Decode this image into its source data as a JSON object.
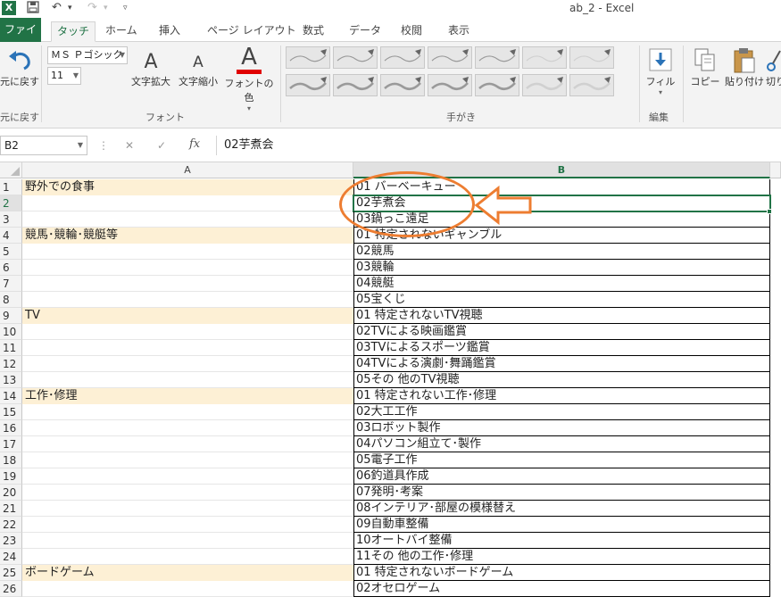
{
  "window": {
    "title": "ab_2 - Excel"
  },
  "tabs": [
    "ファイル",
    "タッチ",
    "ホーム",
    "挿入",
    "ページ レイアウト",
    "数式",
    "データ",
    "校閲",
    "表示"
  ],
  "ribbon": {
    "undo_label": "元に戻す",
    "undo_group_label": "元に戻す",
    "font_name": "ＭＳ Ｐゴシック",
    "font_size": "11",
    "grow_font": "文字拡大",
    "shrink_font": "文字縮小",
    "font_color": "フォントの色",
    "font_group_label": "フォント",
    "ink_group_label": "手がき",
    "fill_label": "フィル",
    "edit_group_label": "編集",
    "copy_label": "コピー",
    "paste_label": "貼り付け",
    "cut_label": "切り"
  },
  "formula_bar": {
    "name_box": "B2",
    "fx": "fx",
    "value": "02芋煮会"
  },
  "columns": [
    "A",
    "B"
  ],
  "rows": [
    {
      "n": "1",
      "a": "野外での食事",
      "b": "01 バーベーキュー"
    },
    {
      "n": "2",
      "a": "",
      "b": "02芋煮会"
    },
    {
      "n": "3",
      "a": "",
      "b": "03鍋っこ遠足"
    },
    {
      "n": "4",
      "a": "競馬･競輪･競艇等",
      "b": "01 特定されないギャンブル"
    },
    {
      "n": "5",
      "a": "",
      "b": "02競馬"
    },
    {
      "n": "6",
      "a": "",
      "b": "03競輪"
    },
    {
      "n": "7",
      "a": "",
      "b": "04競艇"
    },
    {
      "n": "8",
      "a": "",
      "b": "05宝くじ"
    },
    {
      "n": "9",
      "a": "TV",
      "b": "01 特定されないTV視聴"
    },
    {
      "n": "10",
      "a": "",
      "b": "02TVによる映画鑑賞"
    },
    {
      "n": "11",
      "a": "",
      "b": "03TVによるスポーツ鑑賞"
    },
    {
      "n": "12",
      "a": "",
      "b": "04TVによる演劇･舞踊鑑賞"
    },
    {
      "n": "13",
      "a": "",
      "b": "05その 他のTV視聴"
    },
    {
      "n": "14",
      "a": "工作･修理",
      "b": "01 特定されない工作･修理"
    },
    {
      "n": "15",
      "a": "",
      "b": "02大工工作"
    },
    {
      "n": "16",
      "a": "",
      "b": "03ロボット製作"
    },
    {
      "n": "17",
      "a": "",
      "b": "04パソコン組立て･製作"
    },
    {
      "n": "18",
      "a": "",
      "b": "05電子工作"
    },
    {
      "n": "19",
      "a": "",
      "b": "06釣道具作成"
    },
    {
      "n": "20",
      "a": "",
      "b": "07発明･考案"
    },
    {
      "n": "21",
      "a": "",
      "b": "08インテリア･部屋の模様替え"
    },
    {
      "n": "22",
      "a": "",
      "b": "09自動車整備"
    },
    {
      "n": "23",
      "a": "",
      "b": "10オートバイ整備"
    },
    {
      "n": "24",
      "a": "",
      "b": "11その 他の工作･修理"
    },
    {
      "n": "25",
      "a": "ボードゲーム",
      "b": "01 特定されないボードゲーム"
    },
    {
      "n": "26",
      "a": "",
      "b": "02オセロゲーム"
    }
  ],
  "highlighted_rows": [
    "1",
    "4",
    "9",
    "14",
    "25"
  ],
  "active_row": "2",
  "colors": {
    "excel_green": "#217346",
    "annotation_orange": "#ed7d31",
    "category_fill": "#fdf0d5"
  }
}
